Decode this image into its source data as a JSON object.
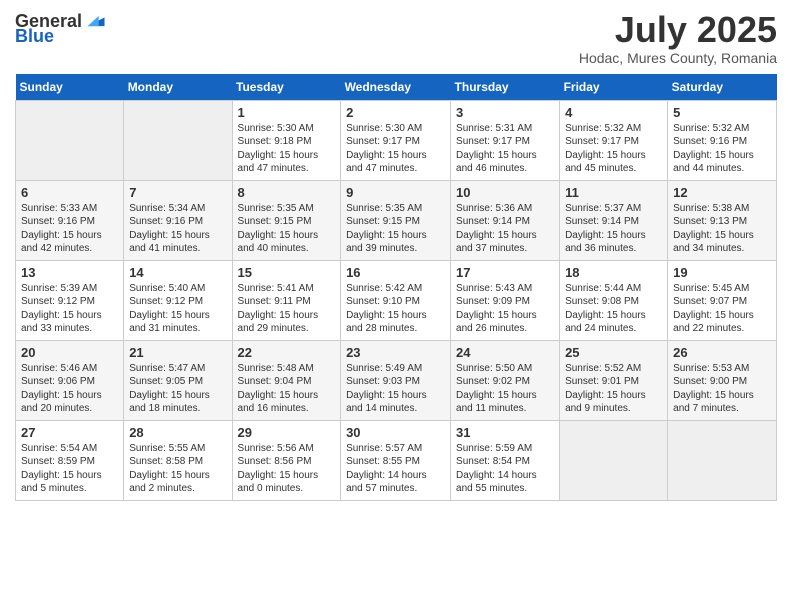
{
  "header": {
    "logo": {
      "general": "General",
      "blue": "Blue"
    },
    "month": "July 2025",
    "location": "Hodac, Mures County, Romania"
  },
  "weekdays": [
    "Sunday",
    "Monday",
    "Tuesday",
    "Wednesday",
    "Thursday",
    "Friday",
    "Saturday"
  ],
  "weeks": [
    [
      {
        "day": "",
        "empty": true
      },
      {
        "day": "",
        "empty": true
      },
      {
        "day": "1",
        "sunrise": "5:30 AM",
        "sunset": "9:18 PM",
        "daylight": "15 hours and 47 minutes."
      },
      {
        "day": "2",
        "sunrise": "5:30 AM",
        "sunset": "9:17 PM",
        "daylight": "15 hours and 47 minutes."
      },
      {
        "day": "3",
        "sunrise": "5:31 AM",
        "sunset": "9:17 PM",
        "daylight": "15 hours and 46 minutes."
      },
      {
        "day": "4",
        "sunrise": "5:32 AM",
        "sunset": "9:17 PM",
        "daylight": "15 hours and 45 minutes."
      },
      {
        "day": "5",
        "sunrise": "5:32 AM",
        "sunset": "9:16 PM",
        "daylight": "15 hours and 44 minutes."
      }
    ],
    [
      {
        "day": "6",
        "sunrise": "5:33 AM",
        "sunset": "9:16 PM",
        "daylight": "15 hours and 42 minutes."
      },
      {
        "day": "7",
        "sunrise": "5:34 AM",
        "sunset": "9:16 PM",
        "daylight": "15 hours and 41 minutes."
      },
      {
        "day": "8",
        "sunrise": "5:35 AM",
        "sunset": "9:15 PM",
        "daylight": "15 hours and 40 minutes."
      },
      {
        "day": "9",
        "sunrise": "5:35 AM",
        "sunset": "9:15 PM",
        "daylight": "15 hours and 39 minutes."
      },
      {
        "day": "10",
        "sunrise": "5:36 AM",
        "sunset": "9:14 PM",
        "daylight": "15 hours and 37 minutes."
      },
      {
        "day": "11",
        "sunrise": "5:37 AM",
        "sunset": "9:14 PM",
        "daylight": "15 hours and 36 minutes."
      },
      {
        "day": "12",
        "sunrise": "5:38 AM",
        "sunset": "9:13 PM",
        "daylight": "15 hours and 34 minutes."
      }
    ],
    [
      {
        "day": "13",
        "sunrise": "5:39 AM",
        "sunset": "9:12 PM",
        "daylight": "15 hours and 33 minutes."
      },
      {
        "day": "14",
        "sunrise": "5:40 AM",
        "sunset": "9:12 PM",
        "daylight": "15 hours and 31 minutes."
      },
      {
        "day": "15",
        "sunrise": "5:41 AM",
        "sunset": "9:11 PM",
        "daylight": "15 hours and 29 minutes."
      },
      {
        "day": "16",
        "sunrise": "5:42 AM",
        "sunset": "9:10 PM",
        "daylight": "15 hours and 28 minutes."
      },
      {
        "day": "17",
        "sunrise": "5:43 AM",
        "sunset": "9:09 PM",
        "daylight": "15 hours and 26 minutes."
      },
      {
        "day": "18",
        "sunrise": "5:44 AM",
        "sunset": "9:08 PM",
        "daylight": "15 hours and 24 minutes."
      },
      {
        "day": "19",
        "sunrise": "5:45 AM",
        "sunset": "9:07 PM",
        "daylight": "15 hours and 22 minutes."
      }
    ],
    [
      {
        "day": "20",
        "sunrise": "5:46 AM",
        "sunset": "9:06 PM",
        "daylight": "15 hours and 20 minutes."
      },
      {
        "day": "21",
        "sunrise": "5:47 AM",
        "sunset": "9:05 PM",
        "daylight": "15 hours and 18 minutes."
      },
      {
        "day": "22",
        "sunrise": "5:48 AM",
        "sunset": "9:04 PM",
        "daylight": "15 hours and 16 minutes."
      },
      {
        "day": "23",
        "sunrise": "5:49 AM",
        "sunset": "9:03 PM",
        "daylight": "15 hours and 14 minutes."
      },
      {
        "day": "24",
        "sunrise": "5:50 AM",
        "sunset": "9:02 PM",
        "daylight": "15 hours and 11 minutes."
      },
      {
        "day": "25",
        "sunrise": "5:52 AM",
        "sunset": "9:01 PM",
        "daylight": "15 hours and 9 minutes."
      },
      {
        "day": "26",
        "sunrise": "5:53 AM",
        "sunset": "9:00 PM",
        "daylight": "15 hours and 7 minutes."
      }
    ],
    [
      {
        "day": "27",
        "sunrise": "5:54 AM",
        "sunset": "8:59 PM",
        "daylight": "15 hours and 5 minutes."
      },
      {
        "day": "28",
        "sunrise": "5:55 AM",
        "sunset": "8:58 PM",
        "daylight": "15 hours and 2 minutes."
      },
      {
        "day": "29",
        "sunrise": "5:56 AM",
        "sunset": "8:56 PM",
        "daylight": "15 hours and 0 minutes."
      },
      {
        "day": "30",
        "sunrise": "5:57 AM",
        "sunset": "8:55 PM",
        "daylight": "14 hours and 57 minutes."
      },
      {
        "day": "31",
        "sunrise": "5:59 AM",
        "sunset": "8:54 PM",
        "daylight": "14 hours and 55 minutes."
      },
      {
        "day": "",
        "empty": true
      },
      {
        "day": "",
        "empty": true
      }
    ]
  ]
}
